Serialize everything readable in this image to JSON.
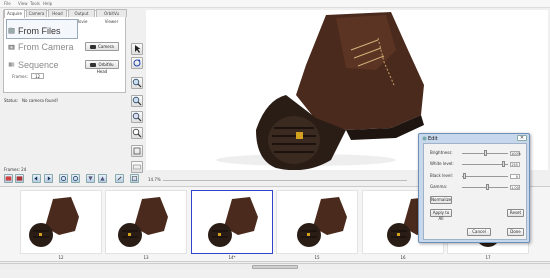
{
  "menu": [
    "File",
    "View",
    "Tools",
    "Help"
  ],
  "tabs": [
    "Acquire",
    "Camera",
    "Head",
    "Output Movie",
    "OrbitVu Viewer"
  ],
  "acquire": {
    "from_files": "From Files",
    "from_camera": "From Camera",
    "sequence": "Sequence",
    "camera_button": "Camera",
    "orbitvu_head_button": "OrbitVu Head",
    "frames_label": "Frames:",
    "frames_value": "12"
  },
  "status": {
    "label": "Status:",
    "value": "No camera found!"
  },
  "tools": [
    "pointer-icon",
    "rotate-icon",
    "zoom-in-icon",
    "zoom-out-icon",
    "zoom-fit-icon",
    "crop-icon",
    "fill-icon"
  ],
  "frames_count_label": "Frames: 24",
  "zoom_label": "14.7%",
  "filmstrip": {
    "frames": [
      {
        "label": "12",
        "selected": false
      },
      {
        "label": "13",
        "selected": false
      },
      {
        "label": "14*",
        "selected": true
      },
      {
        "label": "15",
        "selected": false
      },
      {
        "label": "16",
        "selected": false
      },
      {
        "label": "17",
        "selected": false
      }
    ]
  },
  "edit_dialog": {
    "title": "Edit",
    "close": "✕",
    "params": [
      {
        "label": "Brightness:",
        "value": "100%",
        "level": 0.5
      },
      {
        "label": "White level:",
        "value": "255",
        "level": 0.92
      },
      {
        "label": "Black level:",
        "value": "0",
        "level": 0.02
      },
      {
        "label": "Gamma:",
        "value": "1.00",
        "level": 0.55
      }
    ],
    "normalize": "Normalize",
    "apply_all": "Apply to All",
    "reset": "Reset",
    "cancel": "Cancel",
    "done": "Done"
  },
  "colors": {
    "boot": "#4a2a1c",
    "sole": "#2a1d16",
    "selection": "#3344cc",
    "dialog_frame": "#c8d8ec"
  }
}
